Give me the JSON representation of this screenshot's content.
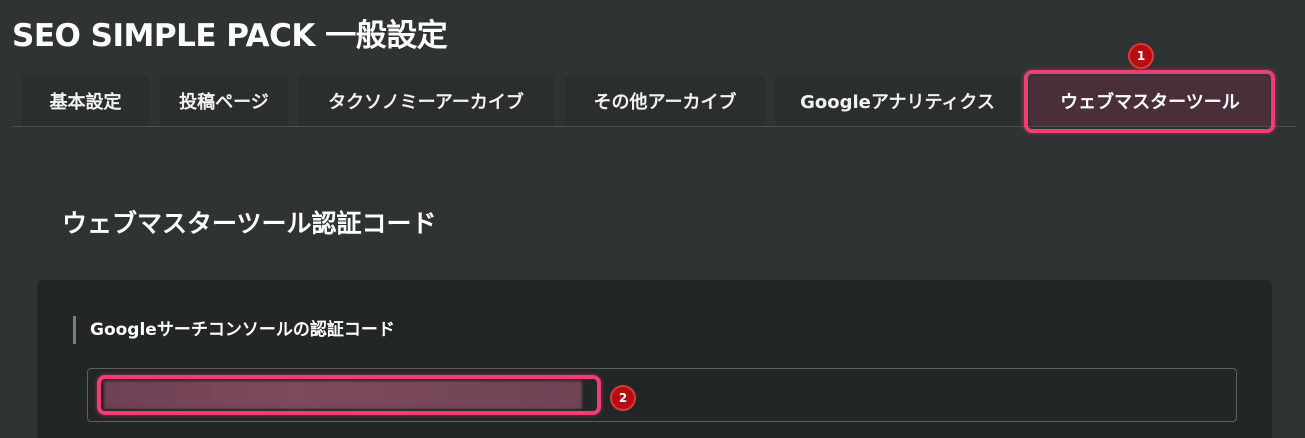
{
  "page": {
    "title": "SEO SIMPLE PACK 一般設定"
  },
  "tabs": [
    {
      "label": "基本設定",
      "active": false
    },
    {
      "label": "投稿ページ",
      "active": false
    },
    {
      "label": "タクソノミーアーカイブ",
      "active": false
    },
    {
      "label": "その他アーカイブ",
      "active": false
    },
    {
      "label": "Googleアナリティクス",
      "active": false
    },
    {
      "label": "ウェブマスターツール",
      "active": true
    }
  ],
  "section": {
    "title": "ウェブマスターツール認証コード"
  },
  "field": {
    "label": "Googleサーチコンソールの認証コード",
    "value": ""
  },
  "annotations": [
    {
      "number": "1"
    },
    {
      "number": "2"
    }
  ],
  "colors": {
    "background": "#2f3333",
    "panel": "#222627",
    "highlight": "#f23d73",
    "badge": "#b80d10",
    "active_tab": "#4a2f3a"
  }
}
